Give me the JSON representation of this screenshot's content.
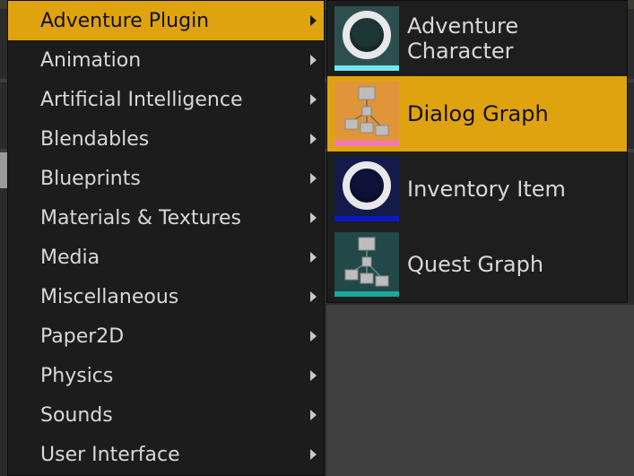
{
  "menu": {
    "items": [
      {
        "label": "Adventure Plugin",
        "active": true
      },
      {
        "label": "Animation"
      },
      {
        "label": "Artificial Intelligence"
      },
      {
        "label": "Blendables"
      },
      {
        "label": "Blueprints"
      },
      {
        "label": "Materials & Textures"
      },
      {
        "label": "Media"
      },
      {
        "label": "Miscellaneous"
      },
      {
        "label": "Paper2D"
      },
      {
        "label": "Physics"
      },
      {
        "label": "Sounds"
      },
      {
        "label": "User Interface"
      }
    ]
  },
  "submenu": {
    "items": [
      {
        "label": "Adventure Character",
        "icon": "ring-icon",
        "thumb_bg": "#2e4f4f",
        "bar_color": "#6fe8f0"
      },
      {
        "label": "Dialog Graph",
        "icon": "graph-icon",
        "thumb_bg": "#e0953a",
        "bar_color": "#f07ab8",
        "active": true
      },
      {
        "label": "Inventory Item",
        "icon": "ring-icon",
        "thumb_bg": "#141a4a",
        "bar_color": "#0a1ac0"
      },
      {
        "label": "Quest Graph",
        "icon": "graph-icon",
        "thumb_bg": "#234848",
        "bar_color": "#1aa89a"
      }
    ]
  },
  "colors": {
    "accent": "#e0a310",
    "menu_bg": "#1c1c1c",
    "text": "#d8d8d8"
  }
}
